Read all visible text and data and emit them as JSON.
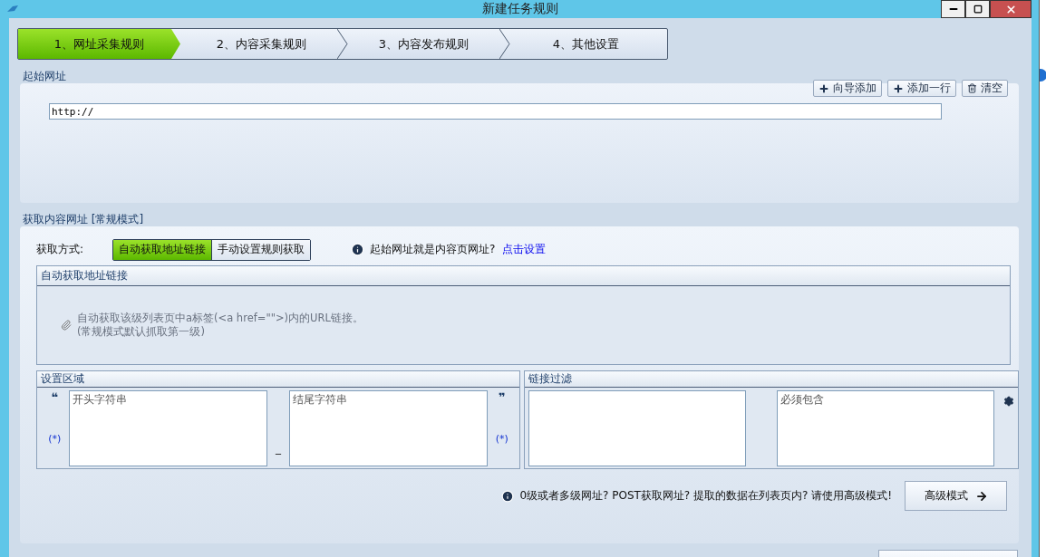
{
  "window": {
    "title": "新建任务规则"
  },
  "steps": [
    {
      "label": "1、网址采集规则",
      "selected": true
    },
    {
      "label": "2、内容采集规则",
      "selected": false
    },
    {
      "label": "3、内容发布规则",
      "selected": false
    },
    {
      "label": "4、其他设置",
      "selected": false
    }
  ],
  "start_urls": {
    "title": "起始网址",
    "buttons": [
      {
        "label": "向导添加",
        "kind": "plus"
      },
      {
        "label": "添加一行",
        "kind": "plus"
      },
      {
        "label": "清空",
        "kind": "trash"
      }
    ],
    "value": "http://"
  },
  "content_urls": {
    "title": "获取内容网址 [常规模式]",
    "method_label": "获取方式:",
    "methods": [
      {
        "label": "自动获取地址链接",
        "selected": true
      },
      {
        "label": "手动设置规则获取",
        "selected": false
      }
    ],
    "hint": "起始网址就是内容页网址?",
    "hint_link": "点击设置",
    "auto_panel": {
      "title": "自动获取地址链接",
      "lines": [
        "自动获取该级列表页中a标签(<a href=\"\">)内的URL链接。",
        "(常规模式默认抓取第一级)"
      ]
    },
    "region": {
      "title": "设置区域",
      "open_quote": "❝",
      "close_quote": "❞",
      "wildcard_left": "(*)",
      "wildcard_right": "(*)",
      "separator": "_",
      "start_placeholder": "开头字符串",
      "end_placeholder": "结尾字符串"
    },
    "filter": {
      "title": "链接过滤",
      "must_contain_placeholder": "必须包含"
    },
    "advanced_hint": "0级或者多级网址? POST获取网址? 提取的数据在列表页内? 请使用高级模式!",
    "advanced_button": "高级模式"
  }
}
